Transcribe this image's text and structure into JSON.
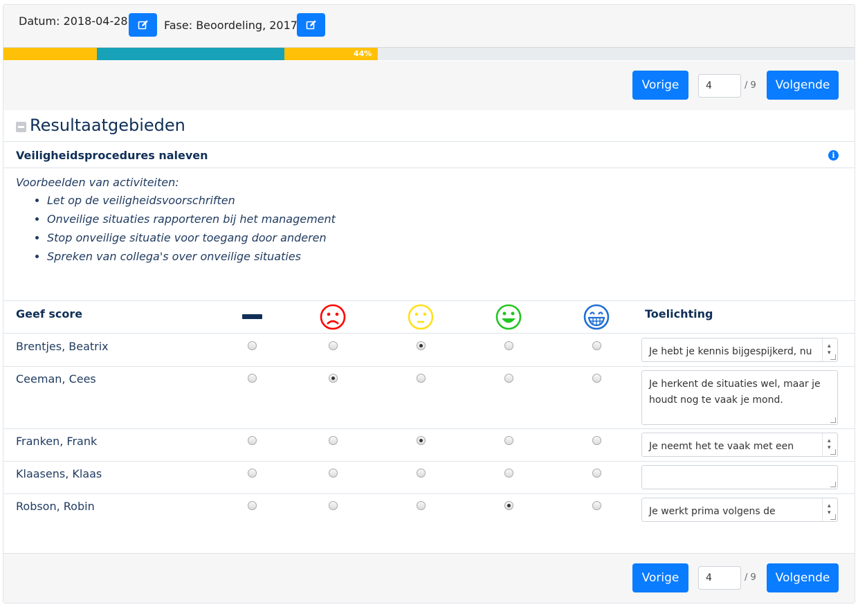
{
  "header": {
    "date_label": "Datum: 2018-04-28",
    "phase_label": "Fase: Beoordeling, 2017",
    "edit_icon": "edit-icon"
  },
  "progress": {
    "label": "44%",
    "segments": [
      {
        "fraction": 0.11,
        "color": "#ffc107"
      },
      {
        "fraction": 0.22,
        "color": "#17a2b8"
      },
      {
        "fraction": 0.11,
        "color": "#ffc107"
      }
    ]
  },
  "pager": {
    "prev_label": "Vorige",
    "next_label": "Volgende",
    "current_page": "4",
    "total_label": "/ 9"
  },
  "section": {
    "title": "Resultaatgebieden",
    "subtitle": "Veiligheidsprocedures naleven",
    "examples_intro": "Voorbeelden van activiteiten:",
    "examples": [
      "Let op de veiligheidsvoorschriften",
      "Onveilige situaties rapporteren bij het management",
      "Stop onveilige situatie voor toegang door anderen",
      "Spreken van collega's over onveilige situaties"
    ]
  },
  "table": {
    "score_header": "Geef score",
    "comment_header": "Toelichting",
    "score_icons": [
      "dash-icon",
      "frown-icon",
      "neutral-icon",
      "smile-icon",
      "grin-icon"
    ],
    "score_colors": [
      "#102f57",
      "#ff0000",
      "#ffe01a",
      "#22c522",
      "#1f6ed4"
    ],
    "rows": [
      {
        "name": "Brentjes, Beatrix",
        "selected": 2,
        "comment": "Je hebt je kennis bijgespijkerd, nu"
      },
      {
        "name": "Ceeman, Cees",
        "selected": 1,
        "comment": "Je herkent de situaties wel, maar je\nhoudt nog te vaak je mond."
      },
      {
        "name": "Franken, Frank",
        "selected": 2,
        "comment": "Je neemt het te vaak met een"
      },
      {
        "name": "Klaasens, Klaas",
        "selected": -1,
        "comment": ""
      },
      {
        "name": "Robson, Robin",
        "selected": 3,
        "comment": "Je werkt prima volgens de"
      }
    ]
  }
}
